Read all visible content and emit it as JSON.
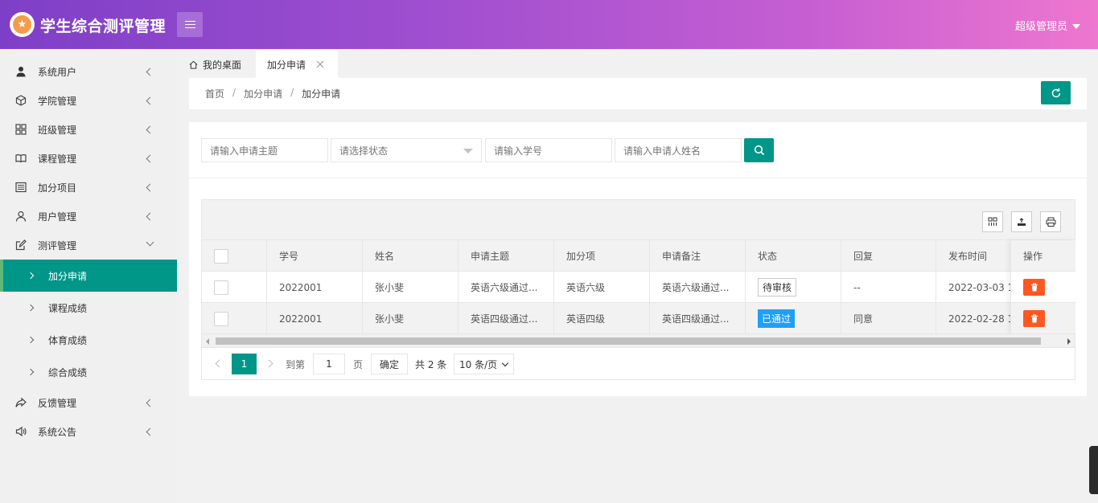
{
  "header": {
    "brand": "学生综合测评管理",
    "user_menu": "超级管理员",
    "colors": {
      "gradient_start": "#7e3fc7",
      "gradient_end": "#ee77cf"
    }
  },
  "sidebar": {
    "items": [
      {
        "label": "系统用户",
        "icon": "user-icon"
      },
      {
        "label": "学院管理",
        "icon": "cube-icon"
      },
      {
        "label": "班级管理",
        "icon": "grid-icon"
      },
      {
        "label": "课程管理",
        "icon": "book-icon"
      },
      {
        "label": "加分项目",
        "icon": "list-icon"
      },
      {
        "label": "用户管理",
        "icon": "person-icon"
      },
      {
        "label": "测评管理",
        "icon": "edit-icon",
        "expanded": true
      },
      {
        "label": "反馈管理",
        "icon": "share-icon"
      },
      {
        "label": "系统公告",
        "icon": "speaker-icon"
      }
    ],
    "subitems": [
      {
        "label": "加分申请",
        "active": true
      },
      {
        "label": "课程成绩"
      },
      {
        "label": "体育成绩"
      },
      {
        "label": "综合成绩"
      }
    ],
    "accent": "#009688"
  },
  "tabs": [
    {
      "label": "我的桌面",
      "icon": "home-icon"
    },
    {
      "label": "加分申请",
      "active": true,
      "closable": true
    }
  ],
  "breadcrumb": [
    "首页",
    "加分申请",
    "加分申请"
  ],
  "search": {
    "subject_placeholder": "请输入申请主题",
    "status_placeholder": "请选择状态",
    "student_no_placeholder": "请输入学号",
    "name_placeholder": "请输入申请人姓名"
  },
  "table": {
    "columns": [
      "学号",
      "姓名",
      "申请主题",
      "加分项",
      "申请备注",
      "状态",
      "回复",
      "发布时间",
      "操作"
    ],
    "rows": [
      {
        "student_no": "2022001",
        "name": "张小斐",
        "subject": "英语六级通过...",
        "bonus_item": "英语六级",
        "remark": "英语六级通过...",
        "status": "待审核",
        "reply": "--",
        "time": "2022-03-03 1"
      },
      {
        "student_no": "2022001",
        "name": "张小斐",
        "subject": "英语四级通过...",
        "bonus_item": "英语四级",
        "remark": "英语四级通过...",
        "status": "已通过",
        "reply": "同意",
        "time": "2022-02-28 1"
      }
    ]
  },
  "pager": {
    "current": "1",
    "goto_label": "到第",
    "goto_value": "1",
    "page_label": "页",
    "confirm": "确定",
    "total": "共 2 条",
    "page_size": "10 条/页"
  }
}
